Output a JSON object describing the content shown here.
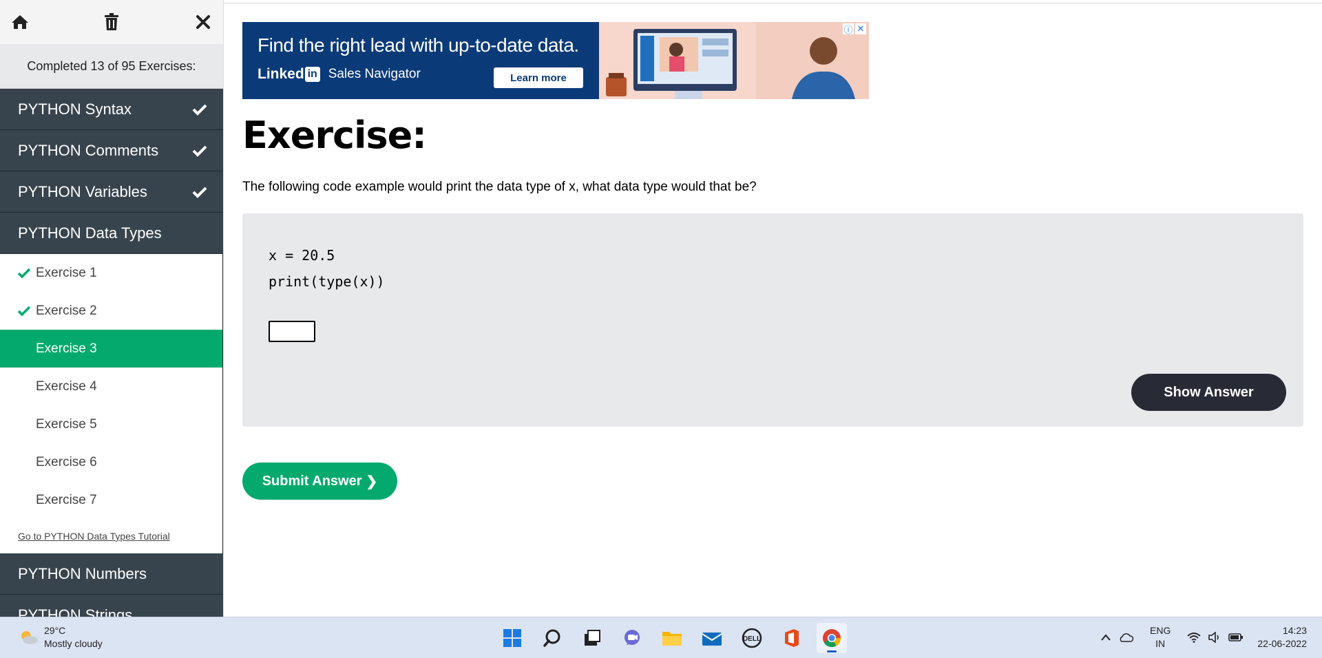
{
  "sidebar": {
    "completed_text": "Completed 13 of 95 Exercises:",
    "sections_before": [
      {
        "label": "PYTHON Syntax",
        "completed": true
      },
      {
        "label": "PYTHON Comments",
        "completed": true
      },
      {
        "label": "PYTHON Variables",
        "completed": true
      }
    ],
    "open_section": {
      "label": "PYTHON Data Types"
    },
    "exercises": [
      {
        "label": "Exercise 1",
        "state": "done"
      },
      {
        "label": "Exercise 2",
        "state": "done"
      },
      {
        "label": "Exercise 3",
        "state": "active"
      },
      {
        "label": "Exercise 4",
        "state": "todo"
      },
      {
        "label": "Exercise 5",
        "state": "todo"
      },
      {
        "label": "Exercise 6",
        "state": "todo"
      },
      {
        "label": "Exercise 7",
        "state": "todo"
      }
    ],
    "tutorial_link": "Go to PYTHON Data Types Tutorial",
    "sections_after": [
      {
        "label": "PYTHON Numbers"
      },
      {
        "label": "PYTHON Strings"
      }
    ]
  },
  "ad": {
    "headline": "Find the right lead with up-to-date data.",
    "brand_bold": "Linked",
    "brand_in": "in",
    "brand_sub": "Sales Navigator",
    "cta": "Learn more"
  },
  "main": {
    "heading": "Exercise:",
    "question": "The following code example would print the data type of x, what data type would that be?",
    "code_line_1": "x = 20.5",
    "code_line_2": "print(type(x))",
    "answer_value": "",
    "show_answer_label": "Show Answer",
    "submit_label": "Submit Answer",
    "submit_chevron": "❯"
  },
  "taskbar": {
    "temperature": "29°C",
    "weather_desc": "Mostly cloudy",
    "lang_1": "ENG",
    "lang_2": "IN",
    "time": "14:23",
    "date": "22-06-2022"
  },
  "colors": {
    "sidebar_section": "#38444d",
    "accent_green": "#04aa6d",
    "dark_button": "#282a35",
    "exercise_bg": "#e7e9eb",
    "taskbar": "#dbe4f3"
  }
}
